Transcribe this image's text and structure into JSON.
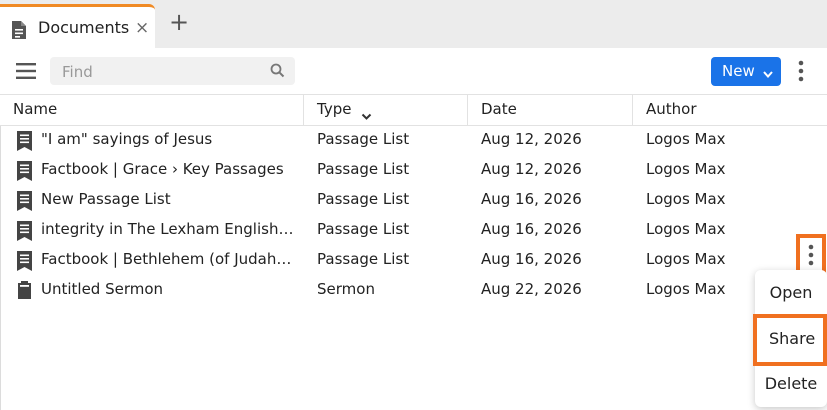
{
  "tab": {
    "title": "Documents",
    "close_icon": "×",
    "add_icon": "+"
  },
  "toolbar": {
    "find_placeholder": "Find",
    "new_label": "New"
  },
  "table": {
    "columns": [
      "Name",
      "Type",
      "Date",
      "Author"
    ],
    "rows": [
      {
        "name": "\"I am\" sayings of Jesus",
        "type": "Passage List",
        "date": "Aug 12, 2026",
        "author": "Logos Max",
        "icon": "passage-list-icon"
      },
      {
        "name": "Factbook | Grace › Key Passages",
        "type": "Passage List",
        "date": "Aug 12, 2026",
        "author": "Logos Max",
        "icon": "passage-list-icon"
      },
      {
        "name": "New Passage List",
        "type": "Passage List",
        "date": "Aug 16, 2026",
        "author": "Logos Max",
        "icon": "passage-list-icon"
      },
      {
        "name": "integrity in The Lexham English Bible",
        "type": "Passage List",
        "date": "Aug 16, 2026",
        "author": "Logos Max",
        "icon": "passage-list-icon"
      },
      {
        "name": "Factbook | Bethlehem (of Judah) › Key Passages",
        "type": "Passage List",
        "date": "Aug 16, 2026",
        "author": "Logos Max",
        "icon": "passage-list-icon"
      },
      {
        "name": "Untitled Sermon",
        "type": "Sermon",
        "date": "Aug 22, 2026",
        "author": "Logos Max",
        "icon": "sermon-icon"
      }
    ]
  },
  "context_menu": {
    "items": [
      "Open",
      "Share",
      "Delete"
    ],
    "highlighted": "Share"
  },
  "colors": {
    "accent": "#1a73e8",
    "tab_indicator": "#f08a24",
    "highlight": "#f07020"
  }
}
